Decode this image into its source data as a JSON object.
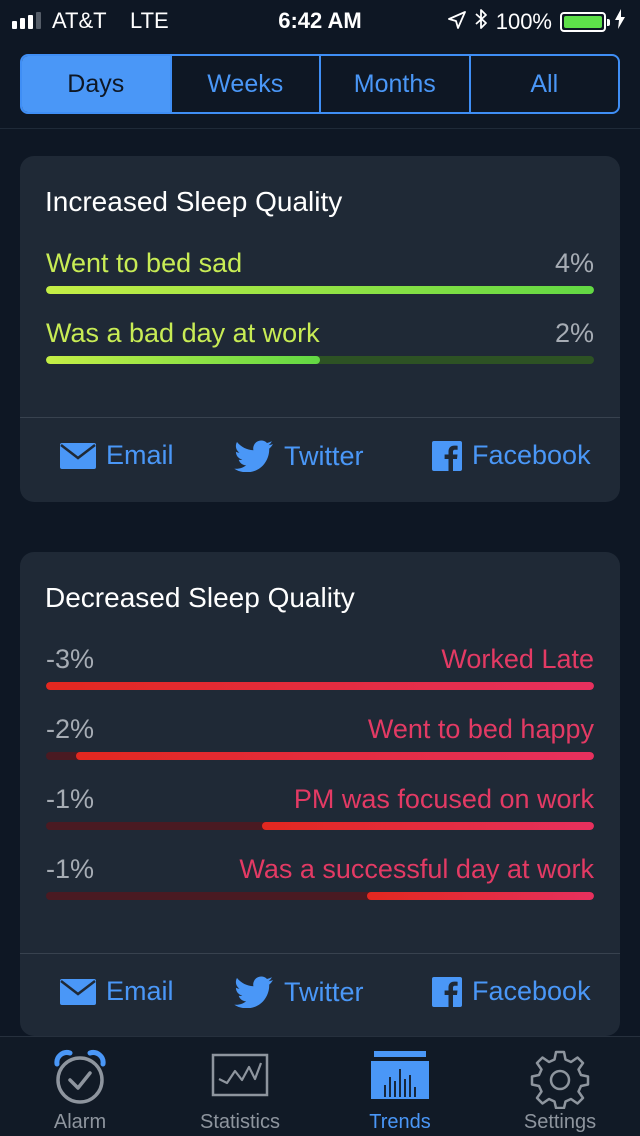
{
  "status": {
    "carrier": "AT&T",
    "network": "LTE",
    "time": "6:42 AM",
    "battery": "100%"
  },
  "segments": [
    {
      "label": "Days",
      "active": true
    },
    {
      "label": "Weeks",
      "active": false
    },
    {
      "label": "Months",
      "active": false
    },
    {
      "label": "All",
      "active": false
    }
  ],
  "increased": {
    "title": "Increased Sleep Quality",
    "items": [
      {
        "label": "Went to bed sad",
        "pct": "4%",
        "fill": 1.0
      },
      {
        "label": "Was a bad day at work",
        "pct": "2%",
        "fill": 0.5
      }
    ],
    "share": {
      "email": "Email",
      "twitter": "Twitter",
      "facebook": "Facebook"
    }
  },
  "decreased": {
    "title": "Decreased Sleep Quality",
    "items": [
      {
        "label": "Worked Late",
        "pct": "-3%",
        "fill": 1.0
      },
      {
        "label": "Went to bed happy",
        "pct": "-2%",
        "fill": 0.945
      },
      {
        "label": "PM was focused on work",
        "pct": "-1%",
        "fill": 0.605
      },
      {
        "label": "Was a successful day at work",
        "pct": "-1%",
        "fill": 0.415
      }
    ],
    "share": {
      "email": "Email",
      "twitter": "Twitter",
      "facebook": "Facebook"
    }
  },
  "tabs": [
    {
      "label": "Alarm",
      "icon": "alarm-clock-icon",
      "active": false
    },
    {
      "label": "Statistics",
      "icon": "statistics-chart-icon",
      "active": false
    },
    {
      "label": "Trends",
      "icon": "trends-bars-icon",
      "active": true
    },
    {
      "label": "Settings",
      "icon": "gear-icon",
      "active": false
    }
  ],
  "colors": {
    "accent": "#4a97f7",
    "positive": "#c8ec55",
    "negative": "#e33a64",
    "card": "#1f2936",
    "background": "#0e1724"
  }
}
